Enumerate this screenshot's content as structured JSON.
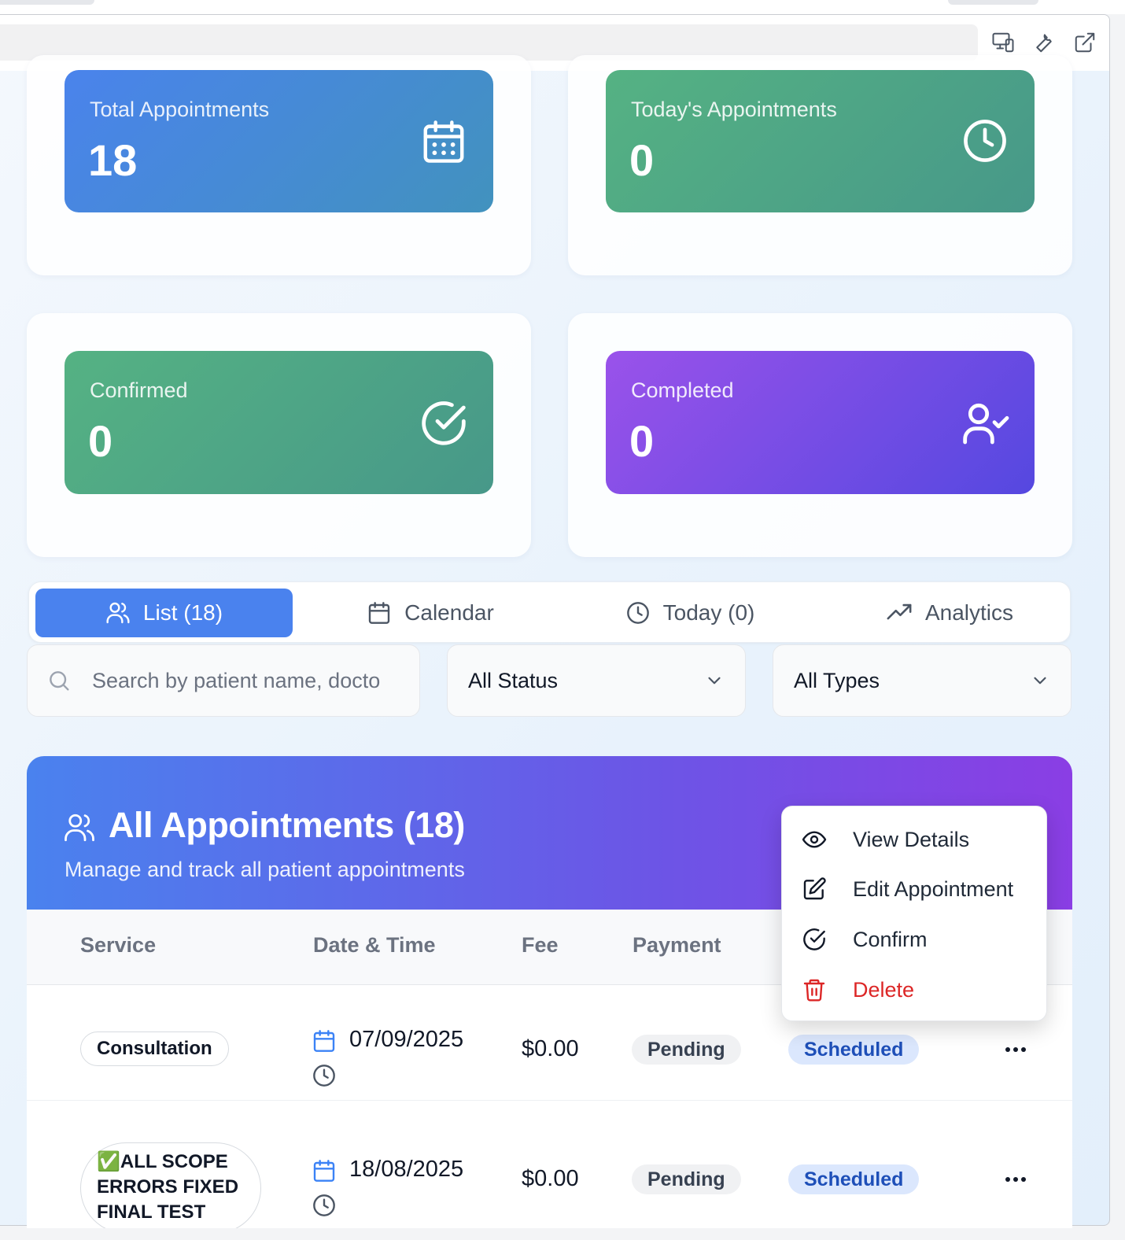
{
  "browser": {
    "icons": [
      "responsive-icon",
      "wrench-icon",
      "external-link-icon"
    ]
  },
  "stats": [
    {
      "label": "Total Appointments",
      "value": "18",
      "icon": "calendar-icon",
      "color_from": "#4a83ec",
      "color_to": "#4292be"
    },
    {
      "label": "Today's Appointments",
      "value": "0",
      "icon": "clock-icon",
      "color_from": "#55b283",
      "color_to": "#479889"
    },
    {
      "label": "Confirmed",
      "value": "0",
      "icon": "check-circle-icon",
      "color_from": "#55b283",
      "color_to": "#479889"
    },
    {
      "label": "Completed",
      "value": "0",
      "icon": "user-check-icon",
      "color_from": "#9a52ea",
      "color_to": "#5548e0"
    }
  ],
  "tabs": [
    {
      "label": "List (18)",
      "icon": "users-icon",
      "active": true
    },
    {
      "label": "Calendar",
      "icon": "calendar-icon",
      "active": false
    },
    {
      "label": "Today (0)",
      "icon": "clock-icon",
      "active": false
    },
    {
      "label": "Analytics",
      "icon": "trending-up-icon",
      "active": false
    }
  ],
  "filters": {
    "search_placeholder": "Search by patient name, docto",
    "status": "All Status",
    "type": "All Types"
  },
  "list": {
    "title": "All Appointments (18)",
    "subtitle": "Manage and track all patient appointments",
    "columns": [
      "Service",
      "Date & Time",
      "Fee",
      "Payment"
    ],
    "rows": [
      {
        "service": "Consultation",
        "date": "07/09/2025",
        "fee": "$0.00",
        "payment": "Pending",
        "status": "Scheduled"
      },
      {
        "service_prefix": "✅",
        "service_lines": [
          "ALL SCOPE",
          "ERRORS FIXED",
          "FINAL TEST"
        ],
        "date": "18/08/2025",
        "fee": "$0.00",
        "payment": "Pending",
        "status": "Scheduled"
      }
    ]
  },
  "menu": [
    {
      "label": "View Details",
      "icon": "eye-icon"
    },
    {
      "label": "Edit Appointment",
      "icon": "edit-icon"
    },
    {
      "label": "Confirm",
      "icon": "check-circle-icon"
    },
    {
      "label": "Delete",
      "icon": "trash-icon",
      "danger": true
    }
  ],
  "colors": {
    "accent": "#4a82ee",
    "danger": "#dc2626",
    "status_text": "#1e4fb8",
    "status_bg": "#dbe7fd"
  }
}
